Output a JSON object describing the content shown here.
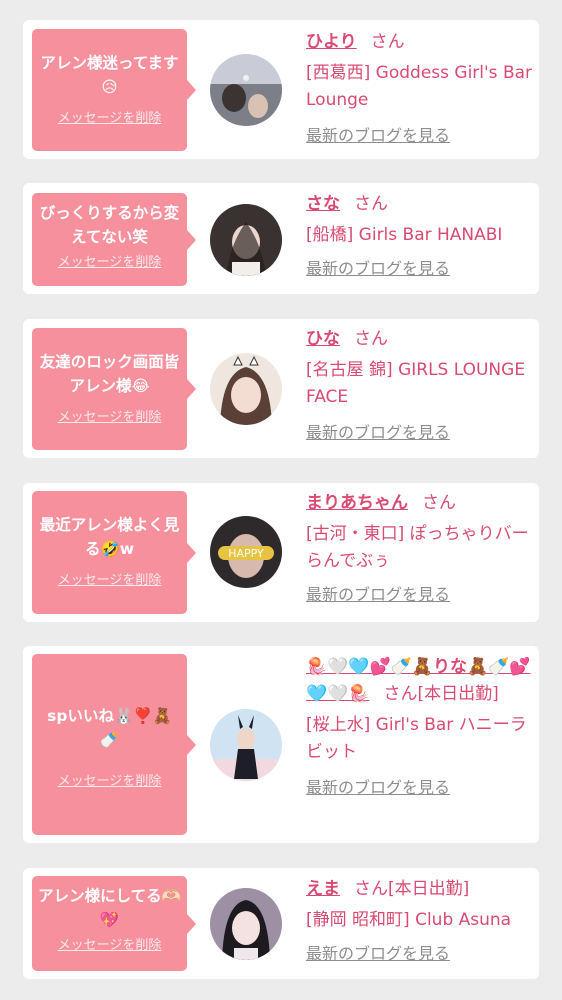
{
  "colors": {
    "page_bg": "#ececec",
    "bubble": "#f6909c",
    "accent_text": "#d94a72",
    "link_gray": "#8d8d8d"
  },
  "delete_label": "メッセージを削除",
  "blog_label": "最新のブログを見る",
  "honorific": "さん",
  "entries": [
    {
      "message": "アレン様迷ってます😥",
      "name": "ひより",
      "status": "",
      "shop": "[西葛西] Goddess Girl's Bar Lounge"
    },
    {
      "message": "びっくりするから変えてない笑",
      "name": "さな",
      "status": "",
      "shop": "[船橋] Girls Bar HANABI"
    },
    {
      "message": "友達のロック画面皆アレン様😂",
      "name": "ひな",
      "status": "",
      "shop": "[名古屋 錦] GIRLS LOUNGE FACE"
    },
    {
      "message": "最近アレン様よく見る🤣w",
      "name": "まりあちゃん",
      "status": "",
      "shop": "[古河・東口] ぽっちゃりバー らんでぶぅ"
    },
    {
      "message": "spいいね🐰❣️🧸🍼",
      "name": "🪼🤍🩵💕🍼🧸りな🧸🍼💕🩵🤍🪼",
      "status": "[本日出勤]",
      "shop": "[桜上水] Girl's Bar ハニーラビット"
    },
    {
      "message": "アレン様にしてる🫶🏻💖",
      "name": "えま",
      "status": "[本日出勤]",
      "shop": "[静岡 昭和町] Club Asuna"
    }
  ]
}
